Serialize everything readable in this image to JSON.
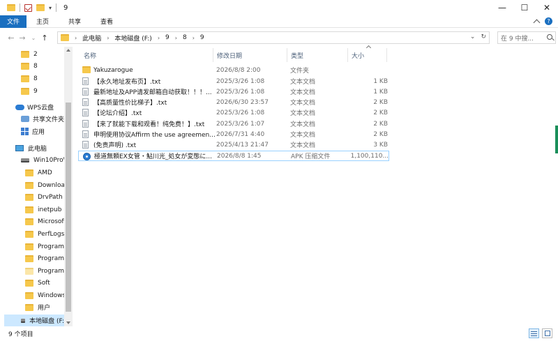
{
  "window": {
    "title": "9"
  },
  "ribbon": {
    "tabs": [
      {
        "label": "文件"
      },
      {
        "label": "主页"
      },
      {
        "label": "共享"
      },
      {
        "label": "查看"
      }
    ]
  },
  "address": {
    "crumbs": [
      "此电脑",
      "本地磁盘 (F:)",
      "9",
      "8",
      "9"
    ],
    "search_placeholder": "在 9 中搜..."
  },
  "nav": {
    "items": [
      {
        "label": "2",
        "icon": "folder-icon"
      },
      {
        "label": "8",
        "icon": "folder-icon"
      },
      {
        "label": "8",
        "icon": "folder-icon"
      },
      {
        "label": "9",
        "icon": "folder-icon"
      },
      {
        "label": "WPS云盘",
        "icon": "cloud-icon"
      },
      {
        "label": "共享文件夹",
        "icon": "share-icon"
      },
      {
        "label": "应用",
        "icon": "apps-icon"
      },
      {
        "label": "此电脑",
        "icon": "pc-icon"
      },
      {
        "label": "Win10ProW",
        "icon": "drive-icon"
      },
      {
        "label": "AMD",
        "icon": "folder-icon"
      },
      {
        "label": "Downloads",
        "icon": "folder-icon"
      },
      {
        "label": "DrvPath",
        "icon": "folder-icon"
      },
      {
        "label": "inetpub",
        "icon": "folder-icon"
      },
      {
        "label": "Microsoft",
        "icon": "folder-icon"
      },
      {
        "label": "PerfLogs",
        "icon": "folder-icon"
      },
      {
        "label": "Program",
        "icon": "folder-icon"
      },
      {
        "label": "Program",
        "icon": "folder-icon"
      },
      {
        "label": "ProgramD",
        "icon": "folder-icon"
      },
      {
        "label": "Soft",
        "icon": "folder-icon"
      },
      {
        "label": "Windows",
        "icon": "folder-icon"
      },
      {
        "label": "用户",
        "icon": "folder-icon"
      },
      {
        "label": "本地磁盘 (F:",
        "icon": "drive-icon"
      }
    ]
  },
  "columns": {
    "name": "名称",
    "date": "修改日期",
    "type": "类型",
    "size": "大小"
  },
  "files": [
    {
      "name": "Yakuzarogue",
      "date": "2026/8/8 2:00",
      "type": "文件夹",
      "size": "",
      "icon": "folder-icon"
    },
    {
      "name": "【永久地址发布页】.txt",
      "date": "2025/3/26 1:08",
      "type": "文本文档",
      "size": "1 KB",
      "icon": "text-file-icon"
    },
    {
      "name": "最新地址及APP请发邮箱自动获取！！！...",
      "date": "2025/3/26 1:08",
      "type": "文本文档",
      "size": "1 KB",
      "icon": "text-file-icon"
    },
    {
      "name": "【高质量性价比梯子】.txt",
      "date": "2026/6/30 23:57",
      "type": "文本文档",
      "size": "2 KB",
      "icon": "text-file-icon"
    },
    {
      "name": "【论坛介绍】.txt",
      "date": "2025/3/26 1:08",
      "type": "文本文档",
      "size": "2 KB",
      "icon": "text-file-icon"
    },
    {
      "name": "【来了就能下载和观看！纯免费！】.txt",
      "date": "2025/3/26 1:07",
      "type": "文本文档",
      "size": "2 KB",
      "icon": "text-file-icon"
    },
    {
      "name": "申明使用协议Affirm the use agreemen...",
      "date": "2026/7/31 4:40",
      "type": "文本文档",
      "size": "2 KB",
      "icon": "text-file-icon"
    },
    {
      "name": "(免责声明) .txt",
      "date": "2025/4/13 21:47",
      "type": "文本文档",
      "size": "3 KB",
      "icon": "text-file-icon"
    },
    {
      "name": "極道無頼EX女管・鮎川光_処女が変態に...",
      "date": "2026/8/8 1:45",
      "type": "APK 压缩文件",
      "size": "1,100,110...",
      "icon": "apk-icon"
    }
  ],
  "status": {
    "count": "9 个项目"
  }
}
